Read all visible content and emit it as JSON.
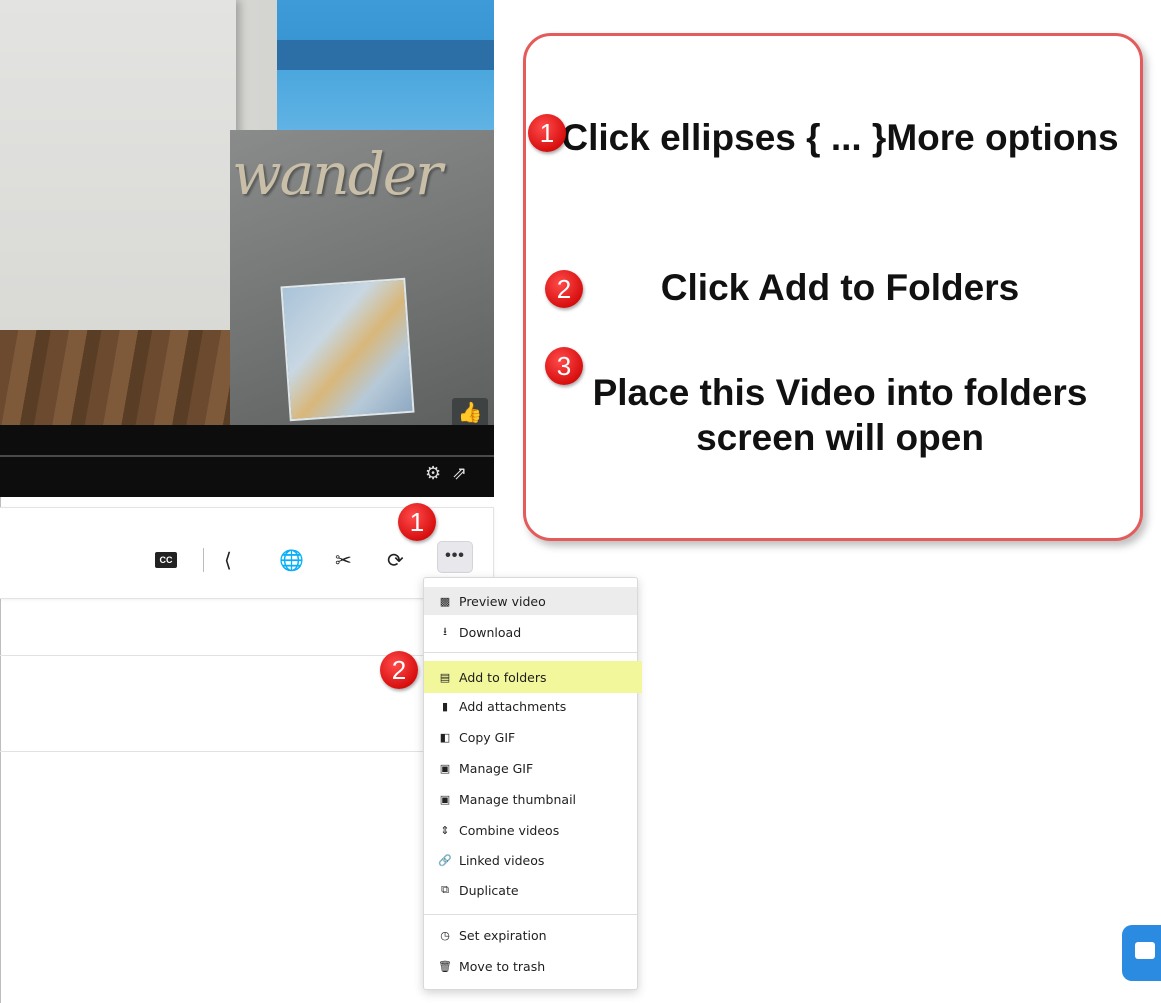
{
  "callout": {
    "step1_text": "Click ellipses { ... }More options",
    "step2_text": "Click Add to Folders",
    "step3_text": "Place this Video into folders screen will open"
  },
  "badges": {
    "one": "1",
    "two": "2",
    "three": "3"
  },
  "video": {
    "sign_text": "wander"
  },
  "toolbar": {
    "cc_label": "CC",
    "more_label": "•••"
  },
  "menu": {
    "items": [
      {
        "label": "Preview video",
        "icon": "video-camera-icon"
      },
      {
        "label": "Download",
        "icon": "download-icon"
      },
      {
        "label": "Add to folders",
        "icon": "folder-list-icon"
      },
      {
        "label": "Add attachments",
        "icon": "file-icon"
      },
      {
        "label": "Copy GIF",
        "icon": "copy-icon"
      },
      {
        "label": "Manage GIF",
        "icon": "image-file-icon"
      },
      {
        "label": "Manage thumbnail",
        "icon": "image-file-icon"
      },
      {
        "label": "Combine videos",
        "icon": "combine-icon"
      },
      {
        "label": "Linked videos",
        "icon": "link-icon"
      },
      {
        "label": "Duplicate",
        "icon": "duplicate-icon"
      },
      {
        "label": "Set expiration",
        "icon": "clock-icon"
      },
      {
        "label": "Move to trash",
        "icon": "trash-icon"
      }
    ]
  },
  "colors": {
    "callout_border": "#e35b5b",
    "highlight": "#f1f79a",
    "badge_red": "#d80f0f",
    "chat_blue": "#2b8be0"
  }
}
